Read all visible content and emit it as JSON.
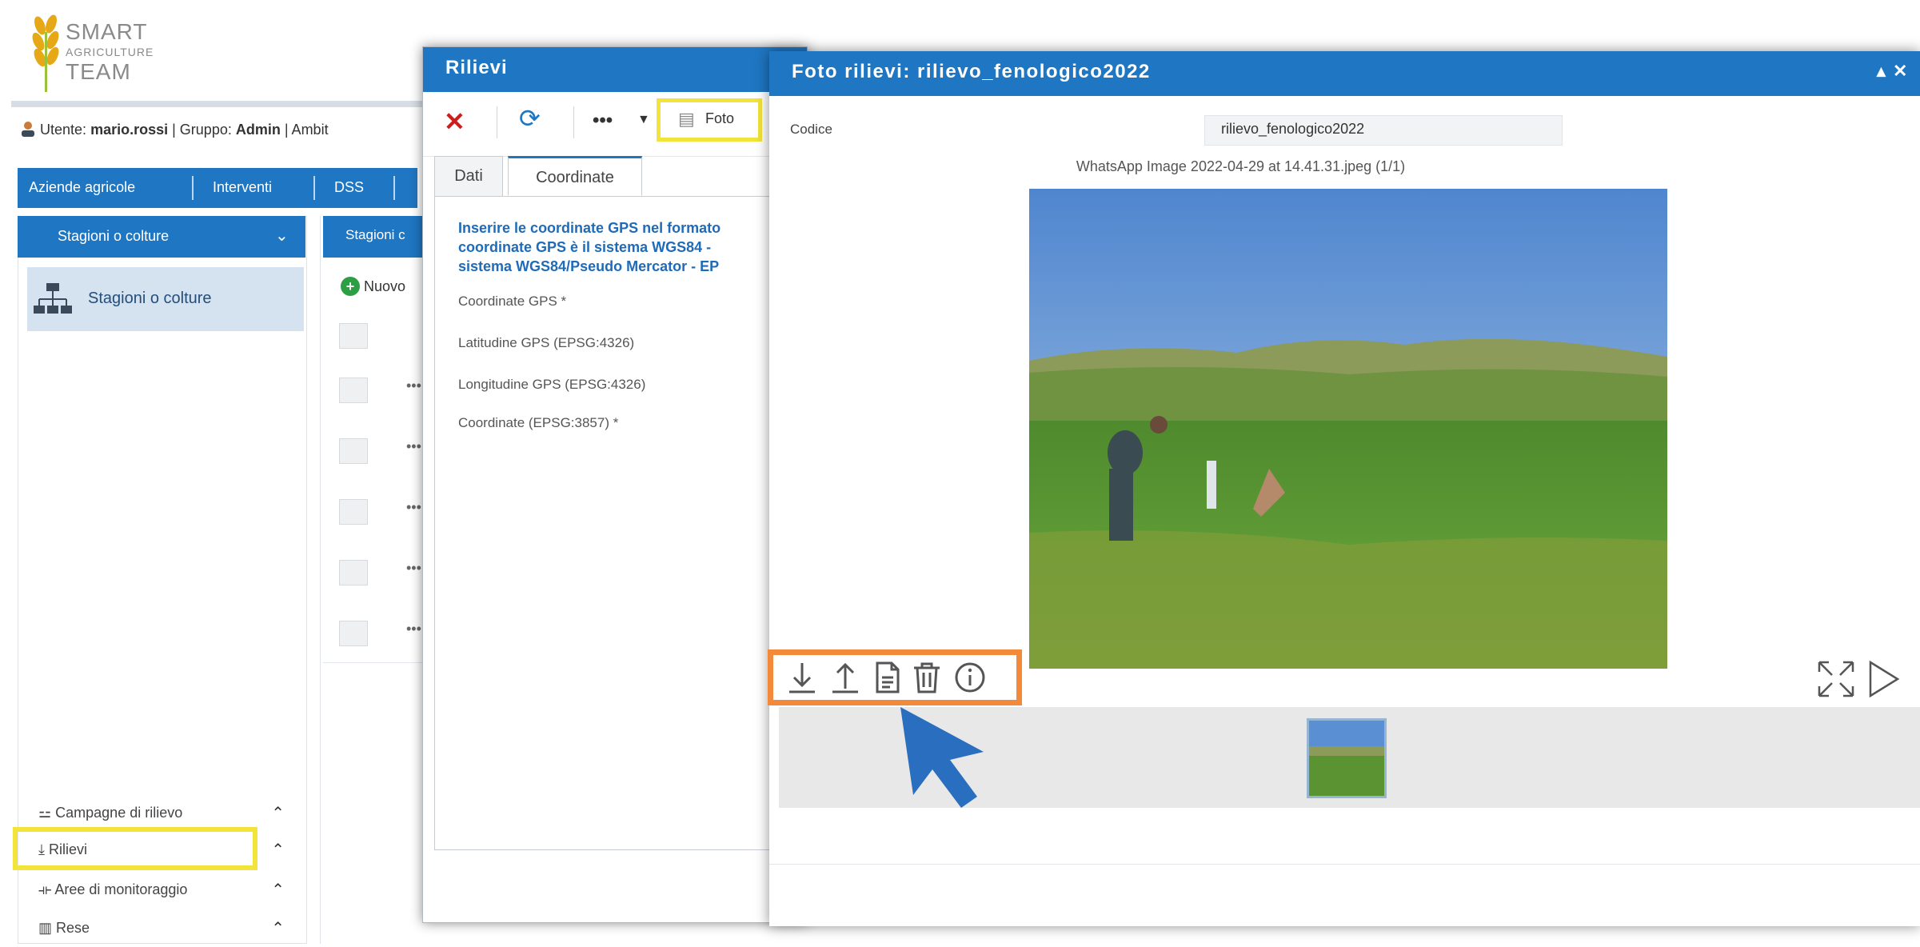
{
  "logo": {
    "line1": "SMART",
    "line2": "AGRICULTURE",
    "line3": "TEAM",
    "icon": "wheat-logo-icon"
  },
  "user_bar": {
    "icon": "user-icon",
    "prefix": "Utente:",
    "user": "mario.rossi",
    "group_prefix": "| Gruppo:",
    "group": "Admin",
    "suffix": "| Ambit"
  },
  "topnav": {
    "items": [
      "Aziende agricole",
      "Interventi",
      "DSS"
    ]
  },
  "sidebar": {
    "dropdown_label": "Stagioni o colture",
    "selected_item": "Stagioni o colture",
    "bottom_items": [
      {
        "label": "Campagne di rilievo",
        "icon": "survey-icon"
      },
      {
        "label": "Rilievi",
        "icon": "download-arrow-icon"
      },
      {
        "label": "Aree di monitoraggio",
        "icon": "area-icon"
      },
      {
        "label": "Rese",
        "icon": "yield-icon"
      }
    ]
  },
  "mid_panel": {
    "tab_label": "Stagioni c",
    "new_button": "Nuovo",
    "row_more": "•••"
  },
  "rilievi_window": {
    "title": "Rilievi",
    "toolbar": {
      "more": "•••",
      "foto_label": "Foto"
    },
    "tabs": [
      "Dati",
      "Coordinate"
    ],
    "info_lines": [
      "Inserire le coordinate GPS nel formato",
      "coordinate GPS è il sistema WGS84 -",
      "sistema WGS84/Pseudo Mercator - EP"
    ],
    "fields": [
      "Coordinate GPS *",
      "Latitudine GPS (EPSG:4326)",
      "Longitudine GPS (EPSG:4326)",
      "Coordinate (EPSG:3857) *"
    ]
  },
  "foto_window": {
    "title": "Foto rilievi: rilievo_fenologico2022",
    "window_controls": "▴ ✕",
    "codice_label": "Codice",
    "codice_value": "rilievo_fenologico2022",
    "file_name": "WhatsApp Image 2022-04-29 at 14.41.31.jpeg (1/1)",
    "actions": [
      "download-icon",
      "upload-icon",
      "file-icon",
      "trash-icon",
      "info-icon"
    ],
    "nav": [
      "fullscreen-icon",
      "next-icon"
    ]
  },
  "colors": {
    "header_blue": "#1f76c2",
    "highlight_yellow": "#f2e43a",
    "highlight_orange": "#f28a3a",
    "pointer_blue": "#2a6fbf",
    "delete_red": "#d01b1b"
  }
}
